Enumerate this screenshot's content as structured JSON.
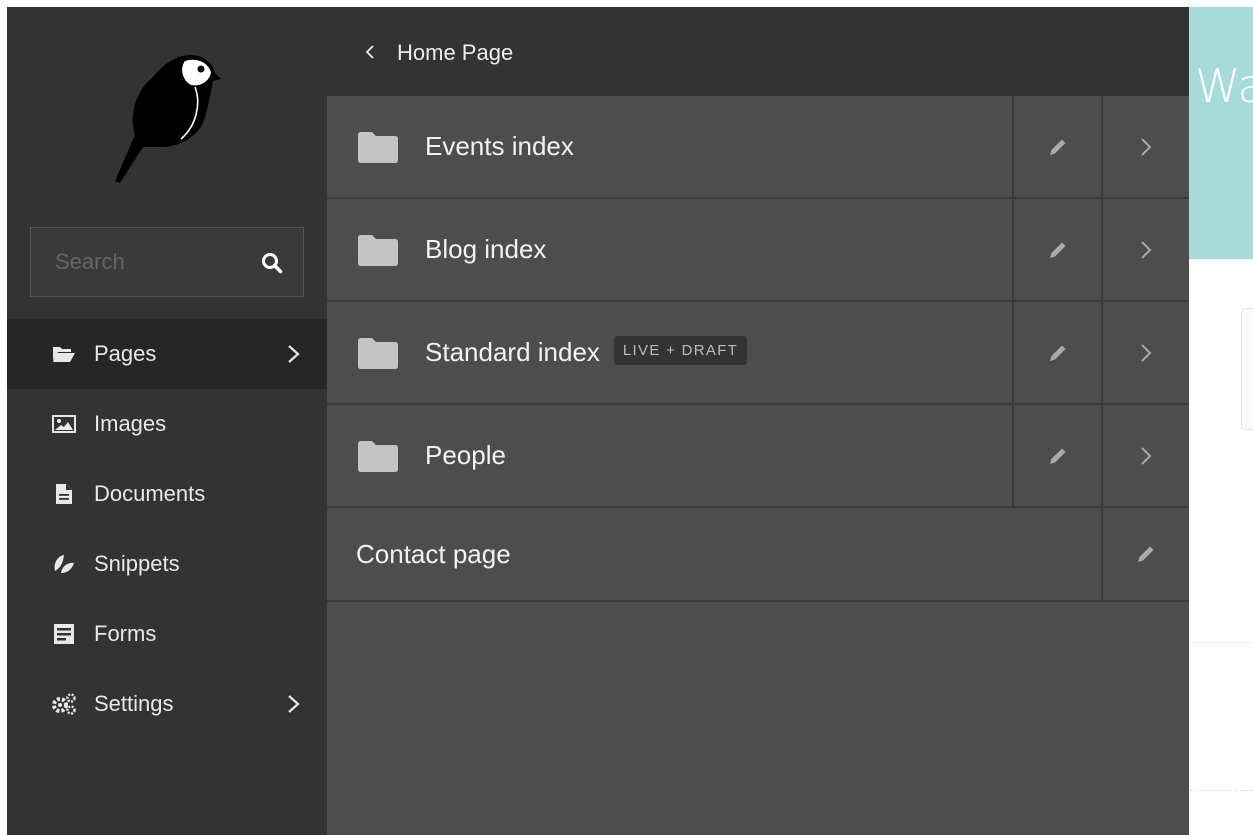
{
  "background": {
    "header_text": "Wa",
    "header_color": "#a6dbd9"
  },
  "sidebar": {
    "logo_icon": "wagtail-bird-logo",
    "search": {
      "placeholder": "Search",
      "value": "",
      "icon": "search-icon"
    },
    "items": [
      {
        "label": "Pages",
        "icon": "folder-open-icon",
        "active": true,
        "has_submenu": true
      },
      {
        "label": "Images",
        "icon": "image-icon",
        "active": false,
        "has_submenu": false
      },
      {
        "label": "Documents",
        "icon": "document-icon",
        "active": false,
        "has_submenu": false
      },
      {
        "label": "Snippets",
        "icon": "snippet-icon",
        "active": false,
        "has_submenu": false
      },
      {
        "label": "Forms",
        "icon": "form-icon",
        "active": false,
        "has_submenu": false
      },
      {
        "label": "Settings",
        "icon": "cogs-icon",
        "active": false,
        "has_submenu": true
      }
    ]
  },
  "explorer": {
    "title": "Home Page",
    "back_icon": "chevron-left-icon",
    "rows": [
      {
        "label": "Events index",
        "has_children": true,
        "badge": ""
      },
      {
        "label": "Blog index",
        "has_children": true,
        "badge": ""
      },
      {
        "label": "Standard index",
        "has_children": true,
        "badge": "LIVE + DRAFT"
      },
      {
        "label": "People",
        "has_children": true,
        "badge": ""
      },
      {
        "label": "Contact page",
        "has_children": false,
        "badge": ""
      }
    ]
  },
  "colors": {
    "sidebar_bg": "#333333",
    "panel_bg": "#4c4d4c",
    "active_item_bg": "#262626",
    "text": "#f2f2f2"
  }
}
